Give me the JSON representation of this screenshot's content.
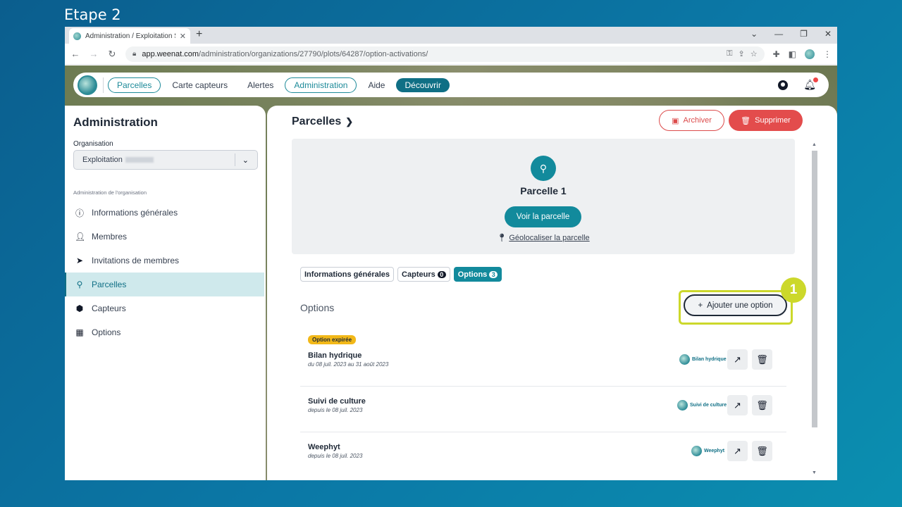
{
  "step_title": "Etape 2",
  "browser": {
    "tab_title": "Administration / Exploitation Sa",
    "url_host": "app.weenat.com",
    "url_path": "/administration/organizations/27790/plots/64287/option-activations/"
  },
  "topnav": {
    "items": [
      "Parcelles",
      "Carte capteurs",
      "Alertes",
      "Administration",
      "Aide",
      "Découvrir"
    ]
  },
  "sidebar": {
    "title": "Administration",
    "org_label": "Organisation",
    "org_value": "Exploitation",
    "section_label": "Administration de l'organisation",
    "items": [
      {
        "label": "Informations générales",
        "icon": "info-icon"
      },
      {
        "label": "Membres",
        "icon": "person-icon"
      },
      {
        "label": "Invitations de membres",
        "icon": "send-icon"
      },
      {
        "label": "Parcelles",
        "icon": "map-pin-icon"
      },
      {
        "label": "Capteurs",
        "icon": "sensor-icon"
      },
      {
        "label": "Options",
        "icon": "options-grid-icon"
      }
    ]
  },
  "main": {
    "breadcrumb": "Parcelles",
    "archive_label": "Archiver",
    "delete_label": "Supprimer",
    "plot_name": "Parcelle 1",
    "view_plot_label": "Voir la parcelle",
    "geolocate_label": "Géolocaliser la parcelle",
    "tabs": [
      {
        "label": "Informations générales",
        "badge": ""
      },
      {
        "label": "Capteurs",
        "badge": "0"
      },
      {
        "label": "Options",
        "badge": "3"
      }
    ],
    "options_heading": "Options",
    "add_option_label": "Ajouter une option",
    "callout_number": "1",
    "options": [
      {
        "status": "Option expirée",
        "name": "Bilan hydrique",
        "date": "du 08 juil. 2023 au 31 août 2023",
        "brand": "Bilan hydrique"
      },
      {
        "status": "",
        "name": "Suivi de culture",
        "date": "depuis le 08 juil. 2023",
        "brand": "Suivi de culture"
      },
      {
        "status": "",
        "name": "Weephyt",
        "date": "depuis le 08 juil. 2023",
        "brand": "Weephyt"
      }
    ]
  },
  "colors": {
    "accent": "#128a9c",
    "danger": "#e34c4c",
    "callout": "#ccd82b",
    "expired": "#f2b818"
  }
}
